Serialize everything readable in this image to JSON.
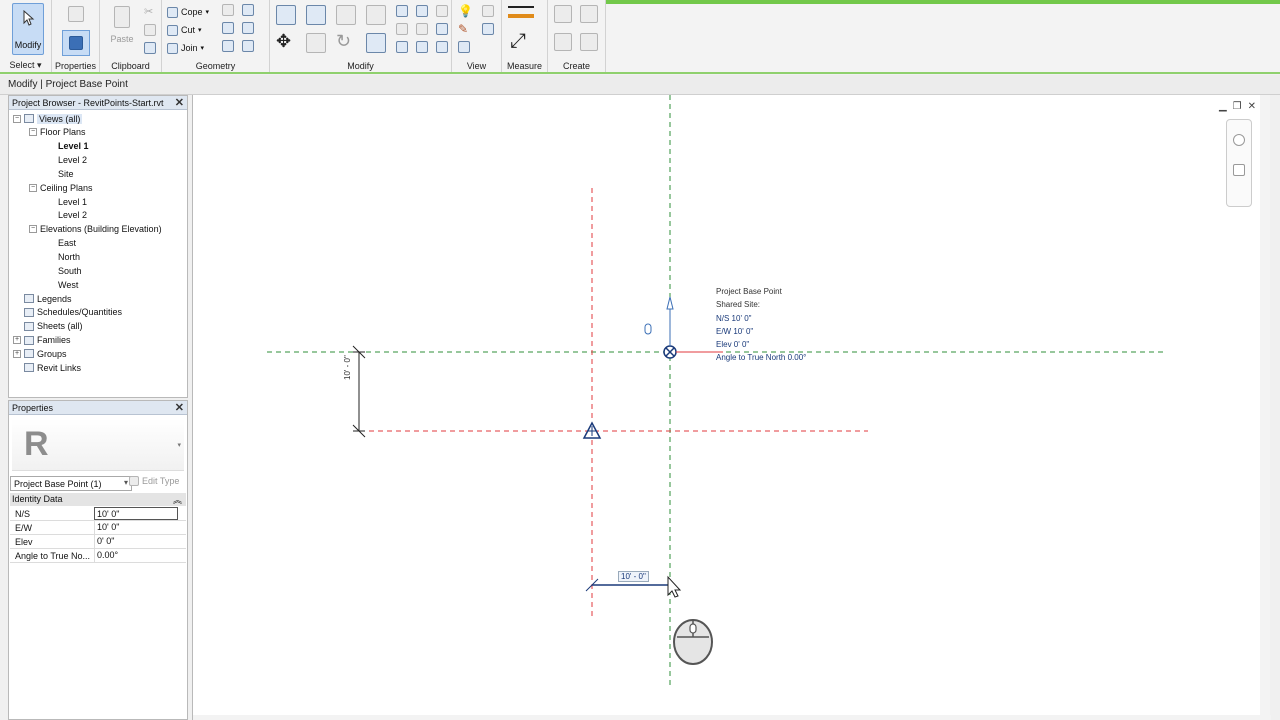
{
  "ribbon": {
    "modify_label": "Modify",
    "panels": {
      "select": "Select",
      "properties": "Properties",
      "clipboard": "Clipboard",
      "geometry": "Geometry",
      "modify": "Modify",
      "view": "View",
      "measure": "Measure",
      "create": "Create"
    },
    "clipboard_paste": "Paste",
    "geometry_cope": "Cope",
    "geometry_cut": "Cut",
    "geometry_join": "Join"
  },
  "context_bar": {
    "text": "Modify | Project Base Point"
  },
  "project_browser": {
    "title": "Project Browser - RevitPoints-Start.rvt",
    "items": [
      {
        "label": "Views (all)"
      },
      {
        "label": "Floor Plans"
      },
      {
        "label": "Level 1"
      },
      {
        "label": "Level 2"
      },
      {
        "label": "Site"
      },
      {
        "label": "Ceiling Plans"
      },
      {
        "label": "Level 1"
      },
      {
        "label": "Level 2"
      },
      {
        "label": "Elevations (Building Elevation)"
      },
      {
        "label": "East"
      },
      {
        "label": "North"
      },
      {
        "label": "South"
      },
      {
        "label": "West"
      },
      {
        "label": "Legends"
      },
      {
        "label": "Schedules/Quantities"
      },
      {
        "label": "Sheets (all)"
      },
      {
        "label": "Families"
      },
      {
        "label": "Groups"
      },
      {
        "label": "Revit Links"
      }
    ]
  },
  "properties": {
    "title": "Properties",
    "type_selector": "Project Base Point (1)",
    "edit_type": "Edit Type",
    "group": "Identity Data",
    "rows": [
      {
        "key": "N/S",
        "value": "10'  0\""
      },
      {
        "key": "E/W",
        "value": "10'  0\""
      },
      {
        "key": "Elev",
        "value": "0'  0\""
      },
      {
        "key": "Angle to True No...",
        "value": "0.00°"
      }
    ]
  },
  "canvas": {
    "base_point_info": {
      "title": "Project Base Point",
      "shared_site": "Shared Site:",
      "ns": "N/S   10'  0\"",
      "ew": "E/W   10'  0\"",
      "elev": "Elev   0'  0\"",
      "angle": "Angle to True North   0.00°"
    },
    "vertical_dim": "10' - 0\"",
    "horizontal_dim": "10' - 0\""
  },
  "colors": {
    "accent_green": "#72c84a",
    "select_blue": "#c7dcf5",
    "dash_red": "#e0393e",
    "dash_green": "#2f8f3a",
    "annotation_blue": "#1a3a7a"
  }
}
